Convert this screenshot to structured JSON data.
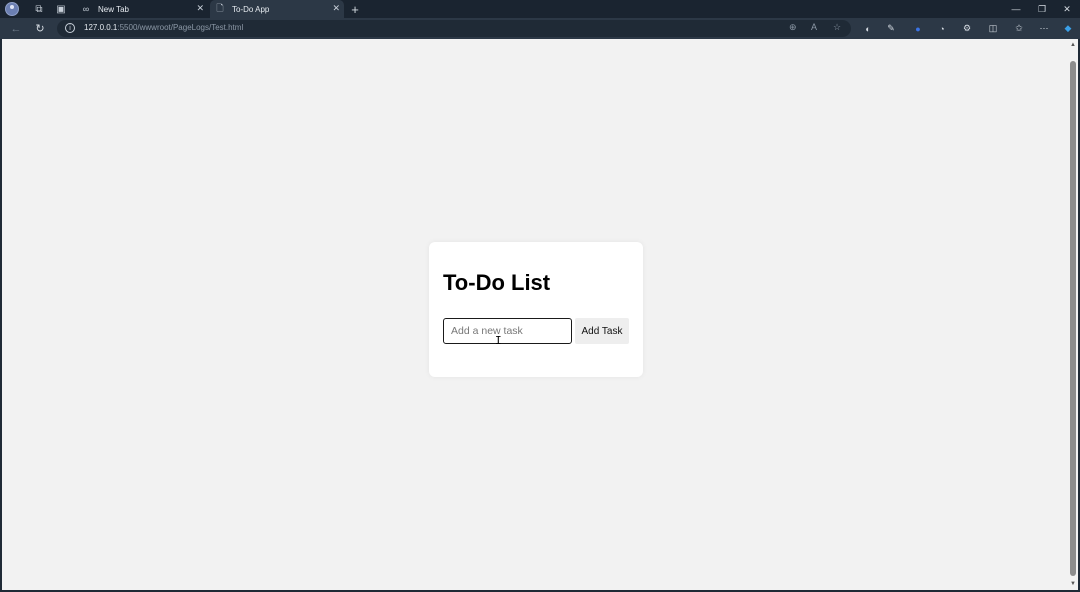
{
  "browser": {
    "tabs": [
      {
        "label": "New Tab",
        "icon": "infinity-icon"
      },
      {
        "label": "To-Do App",
        "icon": "page-icon"
      }
    ],
    "new_tab_symbol": "+",
    "url_host": "127.0.0.1",
    "url_path": ":5500/wwwroot/PageLogs/Test.html"
  },
  "page": {
    "title": "To-Do List",
    "input_placeholder": "Add a new task",
    "input_value": "",
    "add_button_label": "Add Task"
  }
}
